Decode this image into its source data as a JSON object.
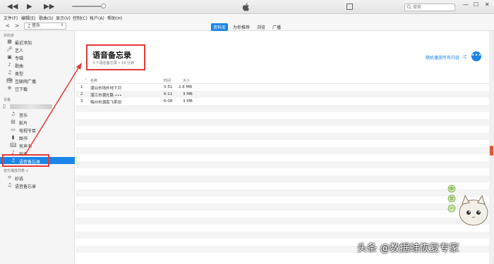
{
  "topbar": {
    "prev_icon": "◀◀",
    "play_icon": "▶",
    "next_icon": "▶▶",
    "search_placeholder": "搜索",
    "window_controls": [
      "—",
      "☐",
      "✕"
    ]
  },
  "menubar": {
    "items": [
      "文件(F)",
      "编辑(E)",
      "歌曲(S)",
      "显示(V)",
      "控制(C)",
      "帐户(A)",
      "帮助(H)"
    ]
  },
  "navbar": {
    "back": "<",
    "forward": ">",
    "media_select": "音乐",
    "tabs": [
      {
        "label": "资料库",
        "active": true
      },
      {
        "label": "为你推荐",
        "active": false
      },
      {
        "label": "浏览",
        "active": false
      },
      {
        "label": "广播",
        "active": false
      }
    ]
  },
  "sidebar": {
    "library_heading": "资料库",
    "library_items": [
      {
        "label": "最近添加",
        "icon": "grid-icon"
      },
      {
        "label": "艺人",
        "icon": "mic-icon"
      },
      {
        "label": "专辑",
        "icon": "album-icon"
      },
      {
        "label": "歌曲",
        "icon": "note-icon"
      },
      {
        "label": "类型",
        "icon": "genre-icon"
      },
      {
        "label": "互联网广播",
        "icon": "radio-icon"
      },
      {
        "label": "已下载",
        "icon": "download-icon"
      }
    ],
    "devices_heading": "设备",
    "device_items": [
      {
        "label": "音乐",
        "icon": "note-icon"
      },
      {
        "label": "影片",
        "icon": "film-icon"
      },
      {
        "label": "电视节目",
        "icon": "tv-icon"
      },
      {
        "label": "图书",
        "icon": "book-icon"
      },
      {
        "label": "有声书",
        "icon": "audiobook-icon"
      },
      {
        "label": "铃声",
        "icon": "bell-icon"
      },
      {
        "label": "语音备忘录",
        "icon": "voice-memo-icon",
        "selected": true
      }
    ],
    "playlists_heading": "音乐播放列表 ∨",
    "playlist_items": [
      {
        "label": "妙选",
        "icon": "genius-icon"
      },
      {
        "label": "语音备忘录",
        "icon": "playlist-icon"
      }
    ]
  },
  "main": {
    "title": "语音备忘录",
    "subtitle": "3 个语音备忘录 • 19 分钟",
    "shuffle_label": "随机播放所有内容",
    "more_label": "•••",
    "columns": {
      "name": "名称",
      "time": "时间",
      "size": "大小"
    },
    "rows": [
      {
        "index": "1",
        "name": "潮汕市场外地下河",
        "time": "5:51",
        "size": "2.8 MB"
      },
      {
        "index": "2",
        "name": "湛江市潮光路 •••",
        "time": "6:11",
        "size": "3 MB"
      },
      {
        "index": "3",
        "name": "梅州市潮南飞茶田",
        "time": "6:08",
        "size": "3 MB"
      }
    ]
  },
  "mascot_badges": [
    "中",
    "毕",
    "一"
  ],
  "watermark": "头条 @数据蛙恢复专家",
  "colors": {
    "accent": "#1a84e8",
    "annotation": "#e53935"
  }
}
